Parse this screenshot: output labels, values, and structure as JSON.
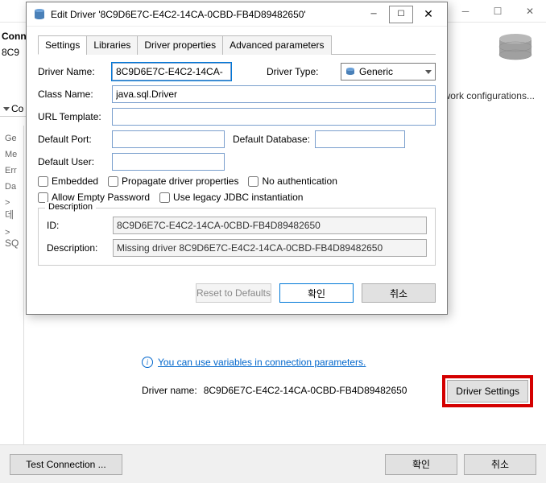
{
  "bg": {
    "conn_label": "Conn",
    "conn_sub": "8C9",
    "conn_tab": "Co",
    "left_items": [
      "Ge",
      "Me",
      "Err",
      "Da",
      "데",
      "SQ"
    ],
    "net_config": "etwork configurations...",
    "info_text": "You can use variables in connection parameters.",
    "driver_name_label": "Driver name:",
    "driver_name_value": "8C9D6E7C-E4C2-14CA-0CBD-FB4D89482650",
    "driver_settings_btn": "Driver Settings",
    "test_btn": "Test Connection ...",
    "ok_btn": "확인",
    "cancel_btn": "취소"
  },
  "modal": {
    "title": "Edit Driver '8C9D6E7C-E4C2-14CA-0CBD-FB4D89482650'",
    "tabs": [
      "Settings",
      "Libraries",
      "Driver properties",
      "Advanced parameters"
    ],
    "labels": {
      "driver_name": "Driver Name:",
      "driver_type": "Driver Type:",
      "class_name": "Class Name:",
      "url_template": "URL Template:",
      "default_port": "Default Port:",
      "default_db": "Default Database:",
      "default_user": "Default User:",
      "description": "Description",
      "id": "ID:",
      "desc_field": "Description:"
    },
    "values": {
      "driver_name": "8C9D6E7C-E4C2-14CA-",
      "driver_type": "Generic",
      "class_name": "java.sql.Driver",
      "url_template": "",
      "default_port": "",
      "default_db": "",
      "default_user": "",
      "id": "8C9D6E7C-E4C2-14CA-0CBD-FB4D89482650",
      "description": "Missing driver 8C9D6E7C-E4C2-14CA-0CBD-FB4D89482650"
    },
    "checks": {
      "embedded": "Embedded",
      "propagate": "Propagate driver properties",
      "no_auth": "No authentication",
      "empty_pw": "Allow Empty Password",
      "legacy": "Use legacy JDBC instantiation"
    },
    "buttons": {
      "reset": "Reset to Defaults",
      "ok": "확인",
      "cancel": "취소"
    }
  }
}
